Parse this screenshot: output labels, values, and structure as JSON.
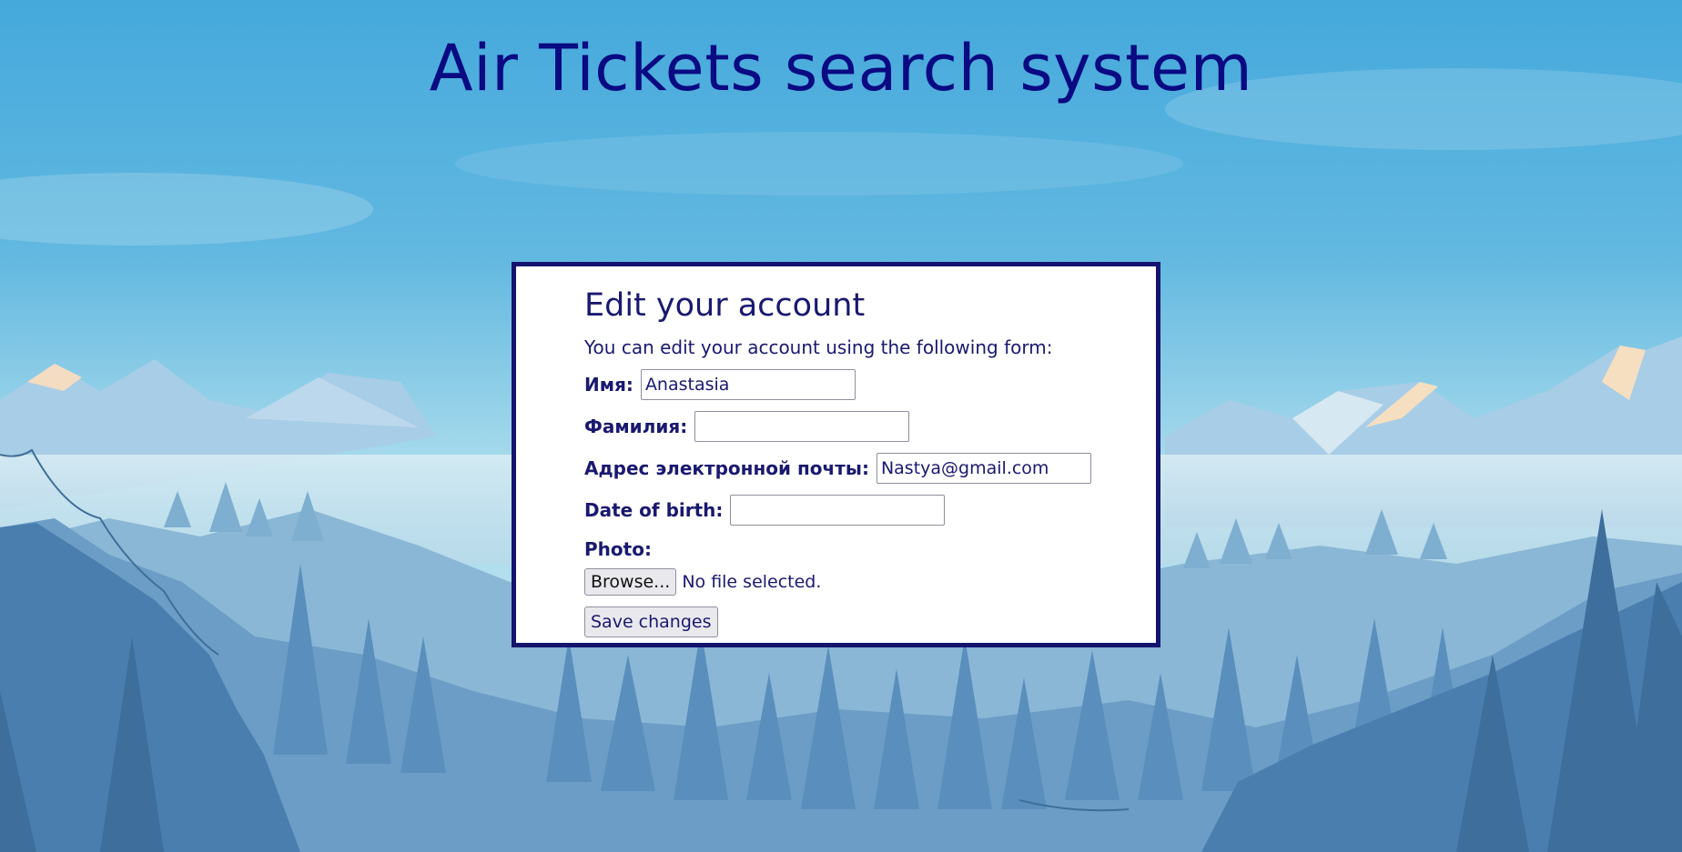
{
  "page": {
    "title": "Air Tickets search system"
  },
  "form": {
    "heading": "Edit your account",
    "intro": "You can edit your account using the following form:",
    "fields": {
      "first_name": {
        "label": "Имя:",
        "value": "Anastasia"
      },
      "last_name": {
        "label": "Фамилия:",
        "value": ""
      },
      "email": {
        "label": "Адрес электронной почты:",
        "value": "Nastya@gmail.com"
      },
      "birth_date": {
        "label": "Date of birth:",
        "value": ""
      },
      "photo": {
        "label": "Photo:",
        "browse_label": "Browse...",
        "status": "No file selected."
      }
    },
    "submit_label": "Save changes"
  },
  "colors": {
    "text": "#191970",
    "title": "#0a0a82",
    "card_border": "#14146e",
    "sky_top": "#45a9dc",
    "sky_bottom": "#a9dbec"
  }
}
